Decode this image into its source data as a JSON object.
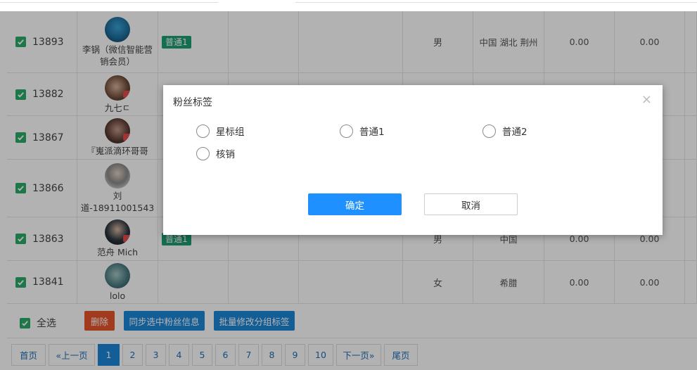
{
  "rows": [
    {
      "id": "13893",
      "name": "李锅（微信智能营销会员）",
      "name_lines": [
        "李锅（微信智能营",
        "销会员）"
      ],
      "tag": "普通1",
      "sex": "男",
      "region": "中国 湖北 荆州",
      "v1": "0.00",
      "v2": "0.00"
    },
    {
      "id": "13882",
      "name_lines": [
        "九七ㄷ"
      ],
      "tag": "",
      "sex": "",
      "region": "",
      "v1": "",
      "v2": ""
    },
    {
      "id": "13867",
      "name_lines": [
        "『嵬派滴环哥哥"
      ],
      "tag": "",
      "sex": "",
      "region": "",
      "v1": "",
      "v2": ""
    },
    {
      "id": "13866",
      "name_lines": [
        "刘",
        "道-18911001543"
      ],
      "tag": "",
      "sex": "",
      "region": "",
      "v1": "",
      "v2": ""
    },
    {
      "id": "13863",
      "name_lines": [
        "范舟 Mich"
      ],
      "tag": "普通1",
      "sex": "男",
      "region": "中国",
      "v1": "0.00",
      "v2": "0.00"
    },
    {
      "id": "13841",
      "name_lines": [
        "lolo"
      ],
      "tag": "",
      "sex": "女",
      "region": "希腊",
      "v1": "0.00",
      "v2": "0.00"
    }
  ],
  "footer": {
    "select_all": "全选",
    "delete": "删除",
    "sync": "同步选中粉丝信息",
    "batch": "批量修改分组标签"
  },
  "pager": [
    "首页",
    "«上一页",
    "1",
    "2",
    "3",
    "4",
    "5",
    "6",
    "7",
    "8",
    "9",
    "10",
    "下一页»",
    "尾页"
  ],
  "pager_active": "1",
  "modal": {
    "title": "粉丝标签",
    "close": "×",
    "options": [
      "星标组",
      "普通1",
      "普通2",
      "核销"
    ],
    "ok": "确定",
    "cancel": "取消"
  },
  "colors": {
    "check_green": "#2bab69",
    "tag_green": "#1e9e73",
    "primary_blue": "#1e87d9",
    "delete_red": "#e8532a",
    "ok_blue": "#1e90ff"
  }
}
